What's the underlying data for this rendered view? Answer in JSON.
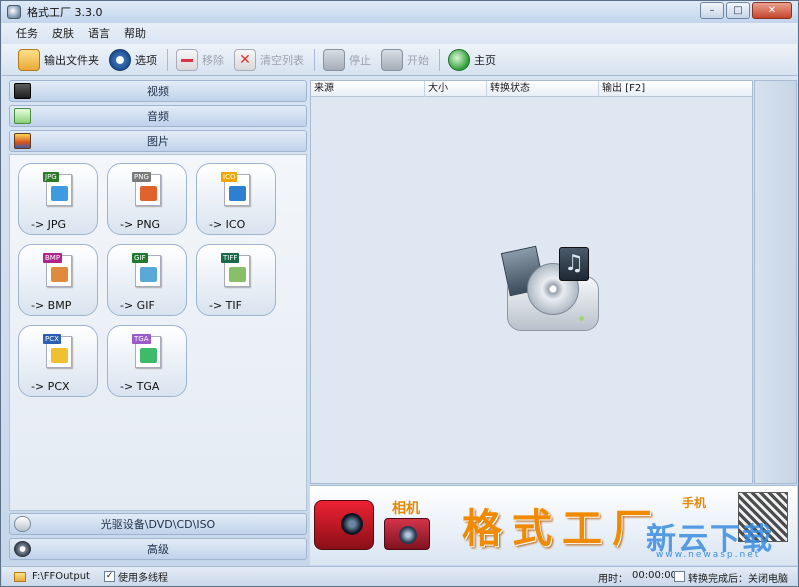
{
  "window": {
    "title": "格式工厂 3.3.0",
    "buttons": {
      "minimize": "–",
      "maximize": "□",
      "close": "✕"
    }
  },
  "menu": [
    "任务",
    "皮肤",
    "语言",
    "帮助"
  ],
  "toolbar": {
    "output_folder": "输出文件夹",
    "options": "选项",
    "remove": "移除",
    "clear_list": "清空列表",
    "stop": "停止",
    "start": "开始",
    "home": "主页"
  },
  "categories": {
    "video": "视频",
    "audio": "音频",
    "image": "图片",
    "disc": "光驱设备\\DVD\\CD\\ISO",
    "advanced": "高级"
  },
  "formats": [
    {
      "tag": "JPG",
      "label": "-> JPG",
      "tag_color": "#2a7a2a",
      "pic_color": "#3d9be0"
    },
    {
      "tag": "PNG",
      "label": "-> PNG",
      "tag_color": "#7a7a7a",
      "pic_color": "#e0622d"
    },
    {
      "tag": "ICO",
      "label": "-> ICO",
      "tag_color": "#f0a500",
      "pic_color": "#2d7fd0"
    },
    {
      "tag": "BMP",
      "label": "-> BMP",
      "tag_color": "#b0238a",
      "pic_color": "#e08a3d"
    },
    {
      "tag": "GIF",
      "label": "-> GIF",
      "tag_color": "#1f7a2f",
      "pic_color": "#5aa8d8"
    },
    {
      "tag": "TIFF",
      "label": "-> TIF",
      "tag_color": "#1a6a4a",
      "pic_color": "#8abf6a"
    },
    {
      "tag": "PCX",
      "label": "-> PCX",
      "tag_color": "#2d5fb0",
      "pic_color": "#f0c030"
    },
    {
      "tag": "TGA",
      "label": "-> TGA",
      "tag_color": "#9a5ac8",
      "pic_color": "#3dba6a"
    }
  ],
  "table": {
    "columns": [
      "来源",
      "大小",
      "转换状态",
      "输出 [F2]"
    ]
  },
  "banner": {
    "title": "格式工厂",
    "camera_text": "相机",
    "phone_text": "手机",
    "watermark": "新云下载",
    "watermark_url": "www.newasp.net"
  },
  "statusbar": {
    "output_path": "F:\\FFOutput",
    "multithread_checked": "✓",
    "multithread_label": "使用多线程",
    "time_label": "用时：",
    "time_value": "00:00:00",
    "after_label": "转换完成后：关闭电脑"
  }
}
